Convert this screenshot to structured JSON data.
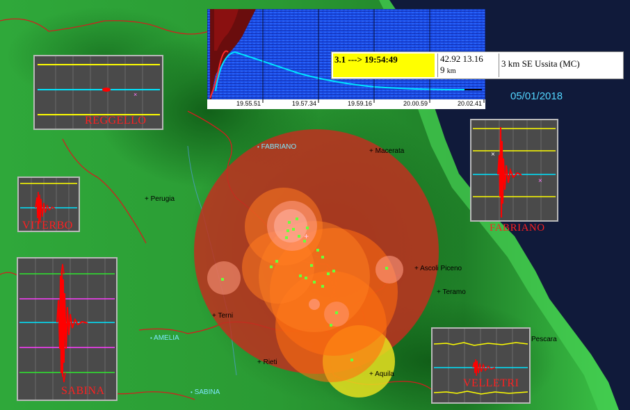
{
  "date": "05/01/2018",
  "event": {
    "magnitude_time": "3.1 ---> 19:54:49",
    "coords": "42.92 13.16",
    "depth_value": "9",
    "depth_unit": "km",
    "location": "3 km SE Ussita (MC)"
  },
  "spectrogram": {
    "time_ticks": [
      "19.55.51",
      "19.57.34",
      "19.59.16",
      "20.00.59",
      "20.02.41"
    ]
  },
  "cities": [
    {
      "name": "FABRIANO",
      "style": "cyan"
    },
    {
      "name": "+ Macerata",
      "style": "black"
    },
    {
      "name": "+ Perugia",
      "style": "black"
    },
    {
      "name": "+ Ascoli Piceno",
      "style": "black"
    },
    {
      "name": "+ Teramo",
      "style": "black"
    },
    {
      "name": "+ Terni",
      "style": "black"
    },
    {
      "name": "AMELIA",
      "style": "cyan"
    },
    {
      "name": "+ Rieti",
      "style": "black"
    },
    {
      "name": "+ Aquila",
      "style": "black"
    },
    {
      "name": "SABINA",
      "style": "cyan"
    },
    {
      "name": "Pescara",
      "style": "black"
    }
  ],
  "stations": {
    "reggello": "REGGELLO",
    "viterbo": "VITERBO",
    "sabina": "SABINA",
    "fabriano": "FABRIANO",
    "velletri": "VELLETRI"
  },
  "colors": {
    "sea": "#101a3a",
    "land_dark": "#0e4a14",
    "land_light": "#36b040",
    "border": "#d21e1e",
    "trace": "#ff0000",
    "yellow_line": "#ffff00",
    "cyan_line": "#00e5ff",
    "magenta_line": "#ff3cff",
    "green_line": "#2ee82e"
  }
}
